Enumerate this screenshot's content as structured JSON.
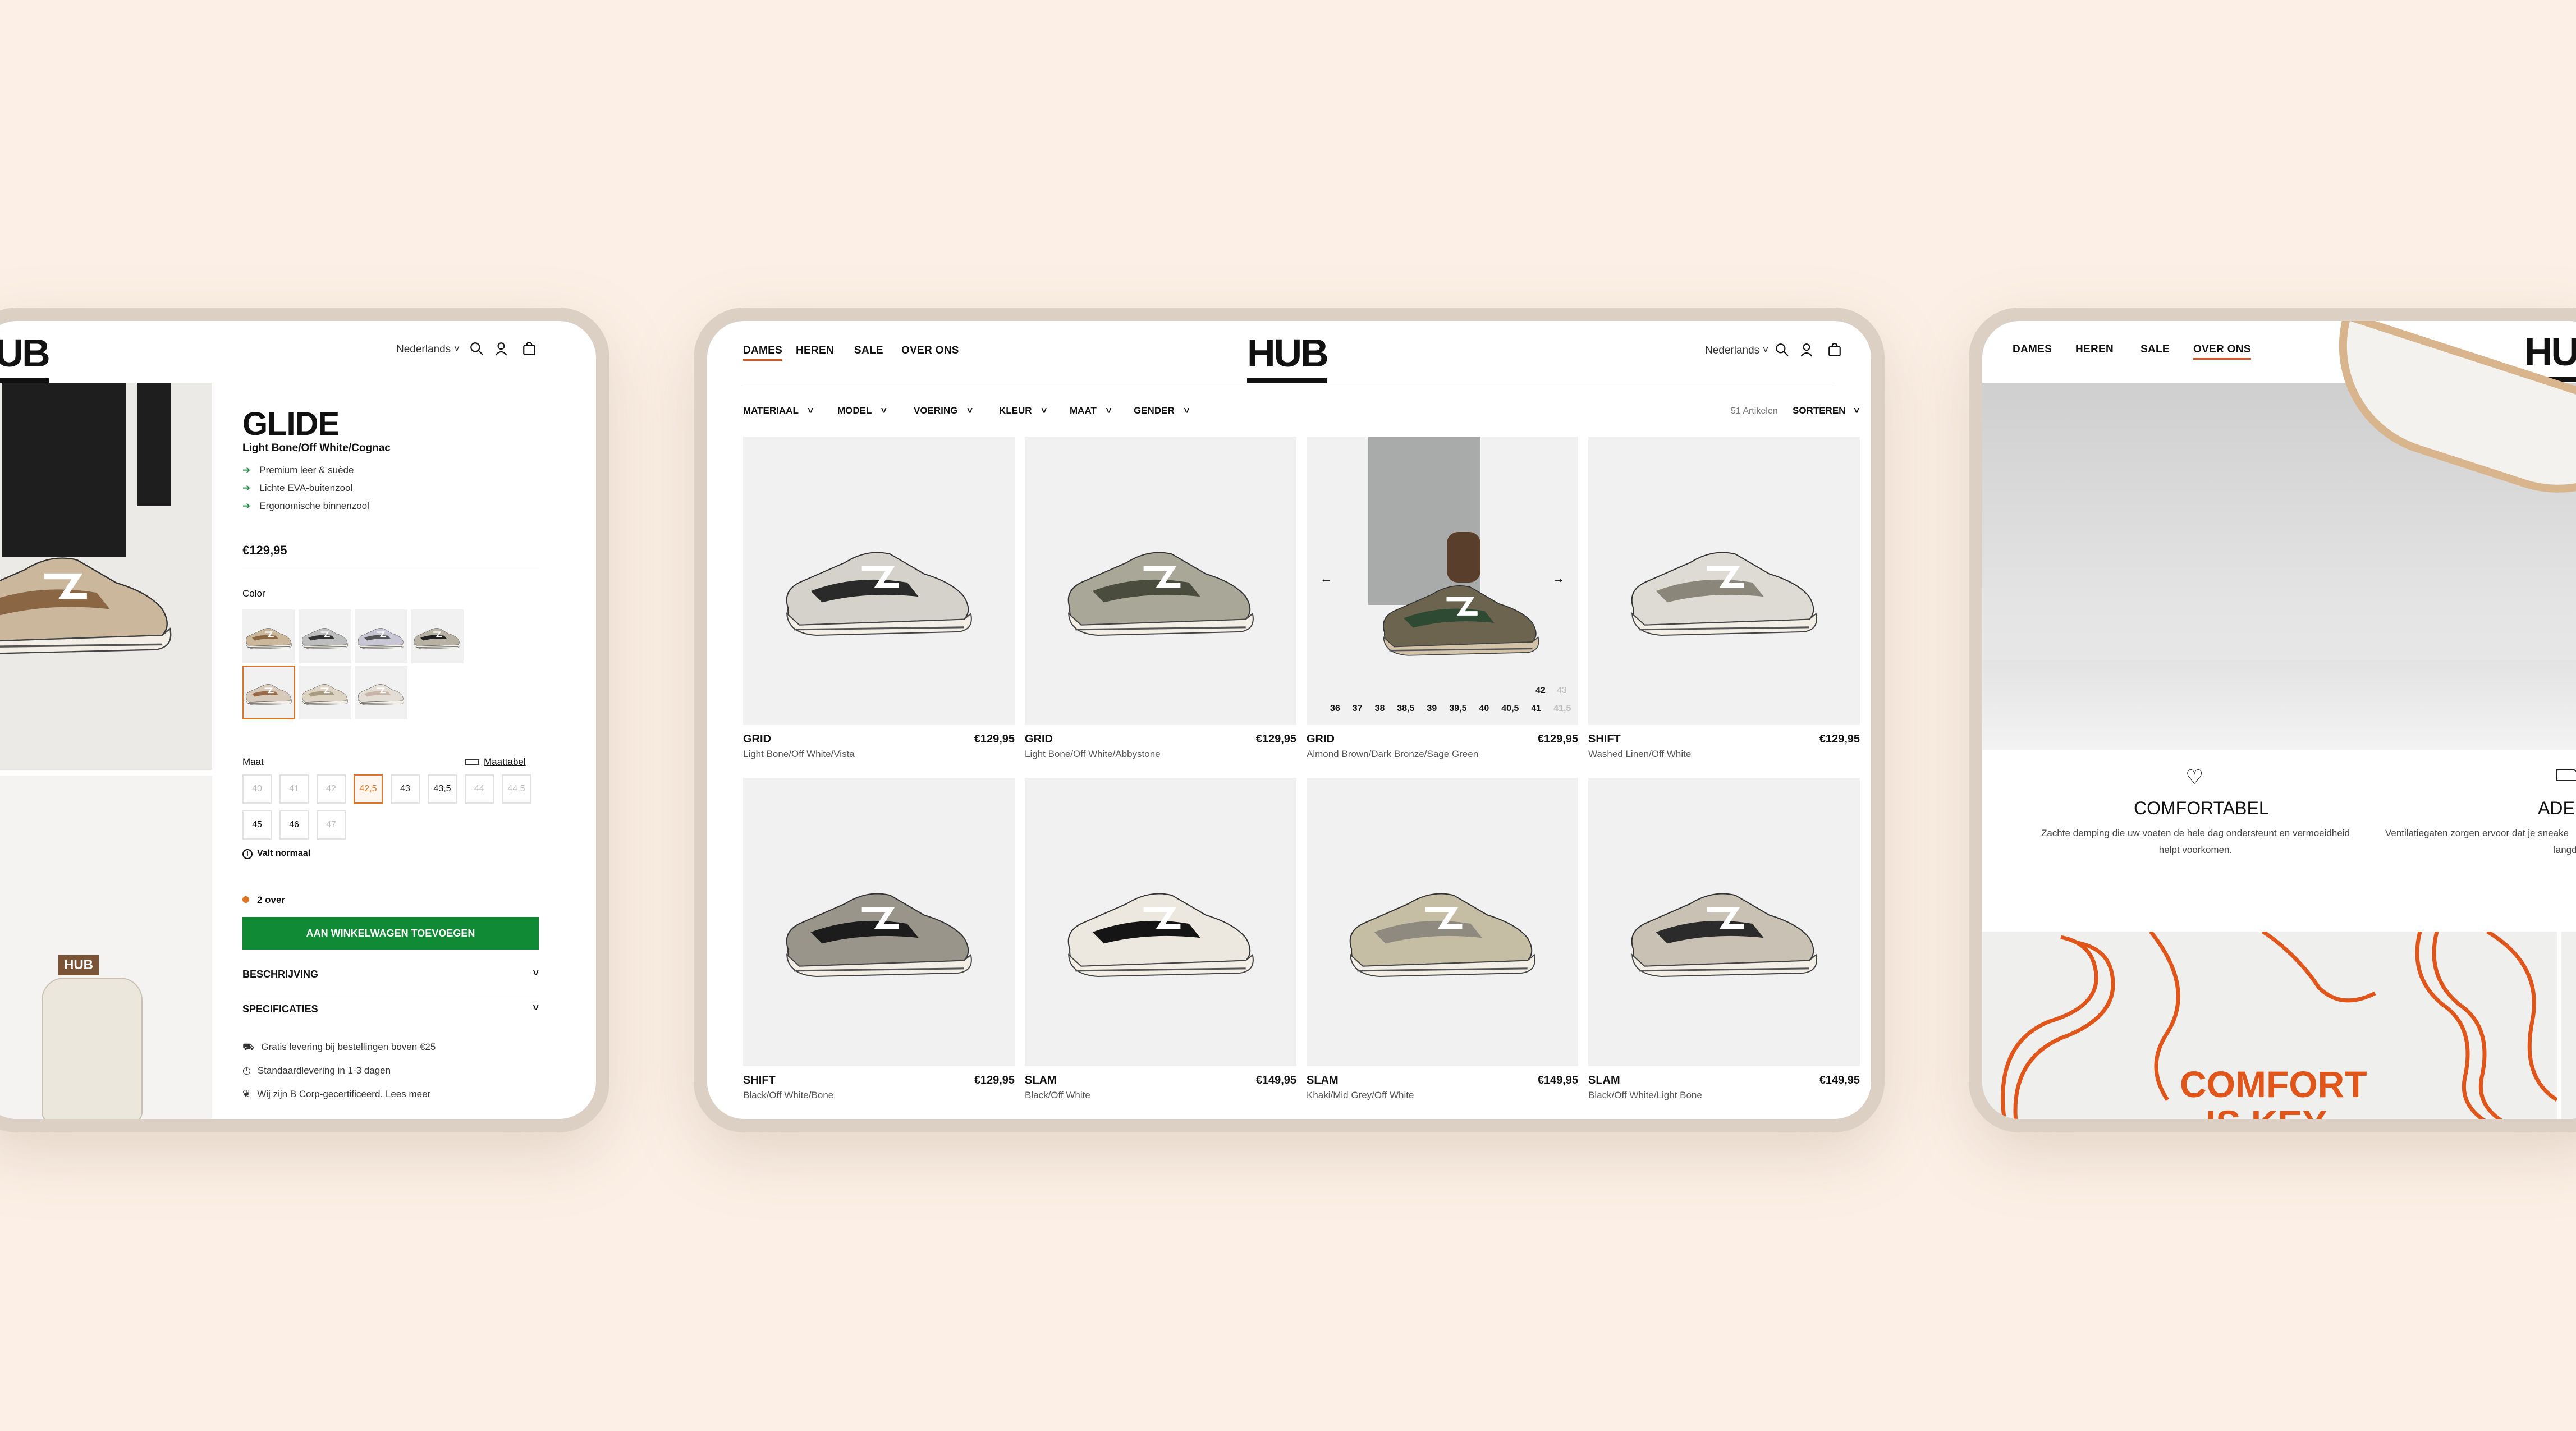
{
  "left_screen": {
    "logo": "HUB",
    "language": "Nederlands",
    "product": {
      "name": "GLIDE",
      "colorway": "Light Bone/Off White/Cognac",
      "features": [
        "Premium leer & suède",
        "Lichte EVA-buitenzool",
        "Ergonomische binnenzool"
      ],
      "price": "€129,95",
      "color_label": "Color",
      "size_label": "Maat",
      "size_chart_link": "Maattabel",
      "sizes": [
        "40",
        "41",
        "42",
        "42,5",
        "43",
        "43,5",
        "44",
        "44,5",
        "45",
        "46",
        "47"
      ],
      "available_sizes": [
        "42,5",
        "43",
        "43,5",
        "45",
        "46"
      ],
      "selected_size": "42,5",
      "fit_note": "Valt normaal",
      "stock_note": "2 over",
      "add_to_cart": "AAN WINKELWAGEN TOEVOEGEN",
      "accordions": [
        "BESCHRIJVING",
        "SPECIFICATIES"
      ],
      "usps": [
        "Gratis levering bij bestellingen boven €25",
        "Standaardlevering in 1-3 dagen",
        "Wij zijn B Corp-gecertificeerd."
      ],
      "read_more": "Lees meer"
    },
    "photo_logo": "HUB"
  },
  "center_screen": {
    "nav": [
      "DAMES",
      "HEREN",
      "SALE",
      "OVER ONS"
    ],
    "active_nav": "DAMES",
    "logo": "HUB",
    "language": "Nederlands",
    "filters": [
      "MATERIAAL",
      "MODEL",
      "VOERING",
      "KLEUR",
      "MAAT",
      "GENDER"
    ],
    "article_count": "51 Artikelen",
    "sort_label": "SORTEREN",
    "quick_sizes_top": [
      "42",
      "43"
    ],
    "quick_sizes": [
      "36",
      "37",
      "38",
      "38,5",
      "39",
      "39,5",
      "40",
      "40,5",
      "41",
      "41,5"
    ],
    "products": [
      {
        "name": "GRID",
        "color": "Light Bone/Off White/Vista",
        "price": "€129,95"
      },
      {
        "name": "GRID",
        "color": "Light Bone/Off White/Abbystone",
        "price": "€129,95"
      },
      {
        "name": "GRID",
        "color": "Almond Brown/Dark Bronze/Sage Green",
        "price": "€129,95"
      },
      {
        "name": "SHIFT",
        "color": "Washed Linen/Off White",
        "price": "€129,95"
      },
      {
        "name": "SHIFT",
        "color": "Black/Off White/Bone",
        "price": "€129,95"
      },
      {
        "name": "SLAM",
        "color": "Black/Off White",
        "price": "€149,95"
      },
      {
        "name": "SLAM",
        "color": "Khaki/Mid Grey/Off White",
        "price": "€149,95"
      },
      {
        "name": "SLAM",
        "color": "Black/Off White/Light Bone",
        "price": "€149,95"
      }
    ]
  },
  "right_screen": {
    "nav": [
      "DAMES",
      "HEREN",
      "SALE",
      "OVER ONS"
    ],
    "active_nav": "OVER ONS",
    "logo": "HUB",
    "feature1_title": "COMFORTABEL",
    "feature1_text_line1": "Zachte demping die uw voeten de hele dag ondersteunt en vermoeidheid",
    "feature1_text_line2": "helpt voorkomen.",
    "feature2_title": "ADEME",
    "feature2_text_line1": "Ventilatiegaten zorgen ervoor dat je sneake",
    "feature2_text_line2": "langdurig d",
    "banner_text_line1": "COMFORT",
    "banner_text_line2": "IS KEY"
  },
  "colors": {
    "background": "#fcf0e6",
    "frame": "#dccfc4",
    "accent_orange": "#e0561a",
    "cta_green": "#118a36"
  }
}
